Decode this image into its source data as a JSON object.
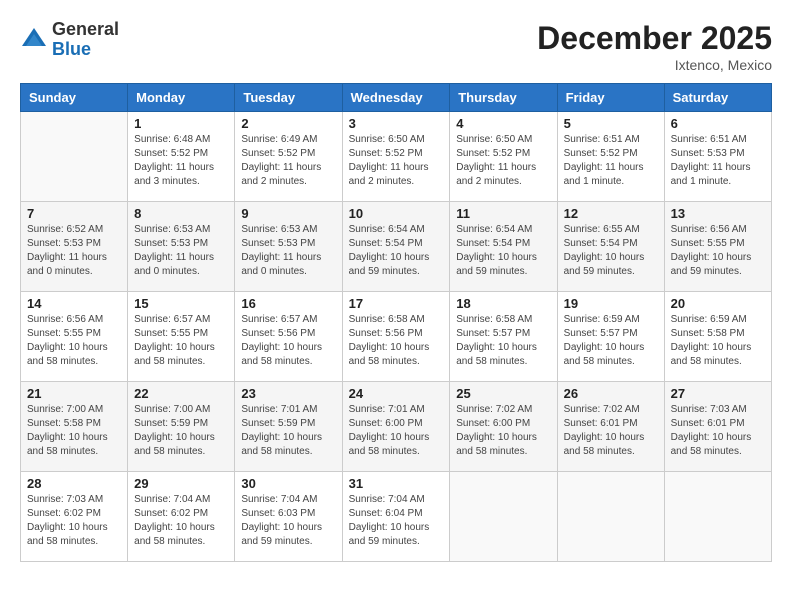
{
  "header": {
    "logo": {
      "general": "General",
      "blue": "Blue"
    },
    "title": "December 2025",
    "location": "Ixtenco, Mexico"
  },
  "days_of_week": [
    "Sunday",
    "Monday",
    "Tuesday",
    "Wednesday",
    "Thursday",
    "Friday",
    "Saturday"
  ],
  "weeks": [
    [
      {
        "day": "",
        "info": ""
      },
      {
        "day": "1",
        "info": "Sunrise: 6:48 AM\nSunset: 5:52 PM\nDaylight: 11 hours\nand 3 minutes."
      },
      {
        "day": "2",
        "info": "Sunrise: 6:49 AM\nSunset: 5:52 PM\nDaylight: 11 hours\nand 2 minutes."
      },
      {
        "day": "3",
        "info": "Sunrise: 6:50 AM\nSunset: 5:52 PM\nDaylight: 11 hours\nand 2 minutes."
      },
      {
        "day": "4",
        "info": "Sunrise: 6:50 AM\nSunset: 5:52 PM\nDaylight: 11 hours\nand 2 minutes."
      },
      {
        "day": "5",
        "info": "Sunrise: 6:51 AM\nSunset: 5:52 PM\nDaylight: 11 hours\nand 1 minute."
      },
      {
        "day": "6",
        "info": "Sunrise: 6:51 AM\nSunset: 5:53 PM\nDaylight: 11 hours\nand 1 minute."
      }
    ],
    [
      {
        "day": "7",
        "info": "Sunrise: 6:52 AM\nSunset: 5:53 PM\nDaylight: 11 hours\nand 0 minutes."
      },
      {
        "day": "8",
        "info": "Sunrise: 6:53 AM\nSunset: 5:53 PM\nDaylight: 11 hours\nand 0 minutes."
      },
      {
        "day": "9",
        "info": "Sunrise: 6:53 AM\nSunset: 5:53 PM\nDaylight: 11 hours\nand 0 minutes."
      },
      {
        "day": "10",
        "info": "Sunrise: 6:54 AM\nSunset: 5:54 PM\nDaylight: 10 hours\nand 59 minutes."
      },
      {
        "day": "11",
        "info": "Sunrise: 6:54 AM\nSunset: 5:54 PM\nDaylight: 10 hours\nand 59 minutes."
      },
      {
        "day": "12",
        "info": "Sunrise: 6:55 AM\nSunset: 5:54 PM\nDaylight: 10 hours\nand 59 minutes."
      },
      {
        "day": "13",
        "info": "Sunrise: 6:56 AM\nSunset: 5:55 PM\nDaylight: 10 hours\nand 59 minutes."
      }
    ],
    [
      {
        "day": "14",
        "info": "Sunrise: 6:56 AM\nSunset: 5:55 PM\nDaylight: 10 hours\nand 58 minutes."
      },
      {
        "day": "15",
        "info": "Sunrise: 6:57 AM\nSunset: 5:55 PM\nDaylight: 10 hours\nand 58 minutes."
      },
      {
        "day": "16",
        "info": "Sunrise: 6:57 AM\nSunset: 5:56 PM\nDaylight: 10 hours\nand 58 minutes."
      },
      {
        "day": "17",
        "info": "Sunrise: 6:58 AM\nSunset: 5:56 PM\nDaylight: 10 hours\nand 58 minutes."
      },
      {
        "day": "18",
        "info": "Sunrise: 6:58 AM\nSunset: 5:57 PM\nDaylight: 10 hours\nand 58 minutes."
      },
      {
        "day": "19",
        "info": "Sunrise: 6:59 AM\nSunset: 5:57 PM\nDaylight: 10 hours\nand 58 minutes."
      },
      {
        "day": "20",
        "info": "Sunrise: 6:59 AM\nSunset: 5:58 PM\nDaylight: 10 hours\nand 58 minutes."
      }
    ],
    [
      {
        "day": "21",
        "info": "Sunrise: 7:00 AM\nSunset: 5:58 PM\nDaylight: 10 hours\nand 58 minutes."
      },
      {
        "day": "22",
        "info": "Sunrise: 7:00 AM\nSunset: 5:59 PM\nDaylight: 10 hours\nand 58 minutes."
      },
      {
        "day": "23",
        "info": "Sunrise: 7:01 AM\nSunset: 5:59 PM\nDaylight: 10 hours\nand 58 minutes."
      },
      {
        "day": "24",
        "info": "Sunrise: 7:01 AM\nSunset: 6:00 PM\nDaylight: 10 hours\nand 58 minutes."
      },
      {
        "day": "25",
        "info": "Sunrise: 7:02 AM\nSunset: 6:00 PM\nDaylight: 10 hours\nand 58 minutes."
      },
      {
        "day": "26",
        "info": "Sunrise: 7:02 AM\nSunset: 6:01 PM\nDaylight: 10 hours\nand 58 minutes."
      },
      {
        "day": "27",
        "info": "Sunrise: 7:03 AM\nSunset: 6:01 PM\nDaylight: 10 hours\nand 58 minutes."
      }
    ],
    [
      {
        "day": "28",
        "info": "Sunrise: 7:03 AM\nSunset: 6:02 PM\nDaylight: 10 hours\nand 58 minutes."
      },
      {
        "day": "29",
        "info": "Sunrise: 7:04 AM\nSunset: 6:02 PM\nDaylight: 10 hours\nand 58 minutes."
      },
      {
        "day": "30",
        "info": "Sunrise: 7:04 AM\nSunset: 6:03 PM\nDaylight: 10 hours\nand 59 minutes."
      },
      {
        "day": "31",
        "info": "Sunrise: 7:04 AM\nSunset: 6:04 PM\nDaylight: 10 hours\nand 59 minutes."
      },
      {
        "day": "",
        "info": ""
      },
      {
        "day": "",
        "info": ""
      },
      {
        "day": "",
        "info": ""
      }
    ]
  ]
}
